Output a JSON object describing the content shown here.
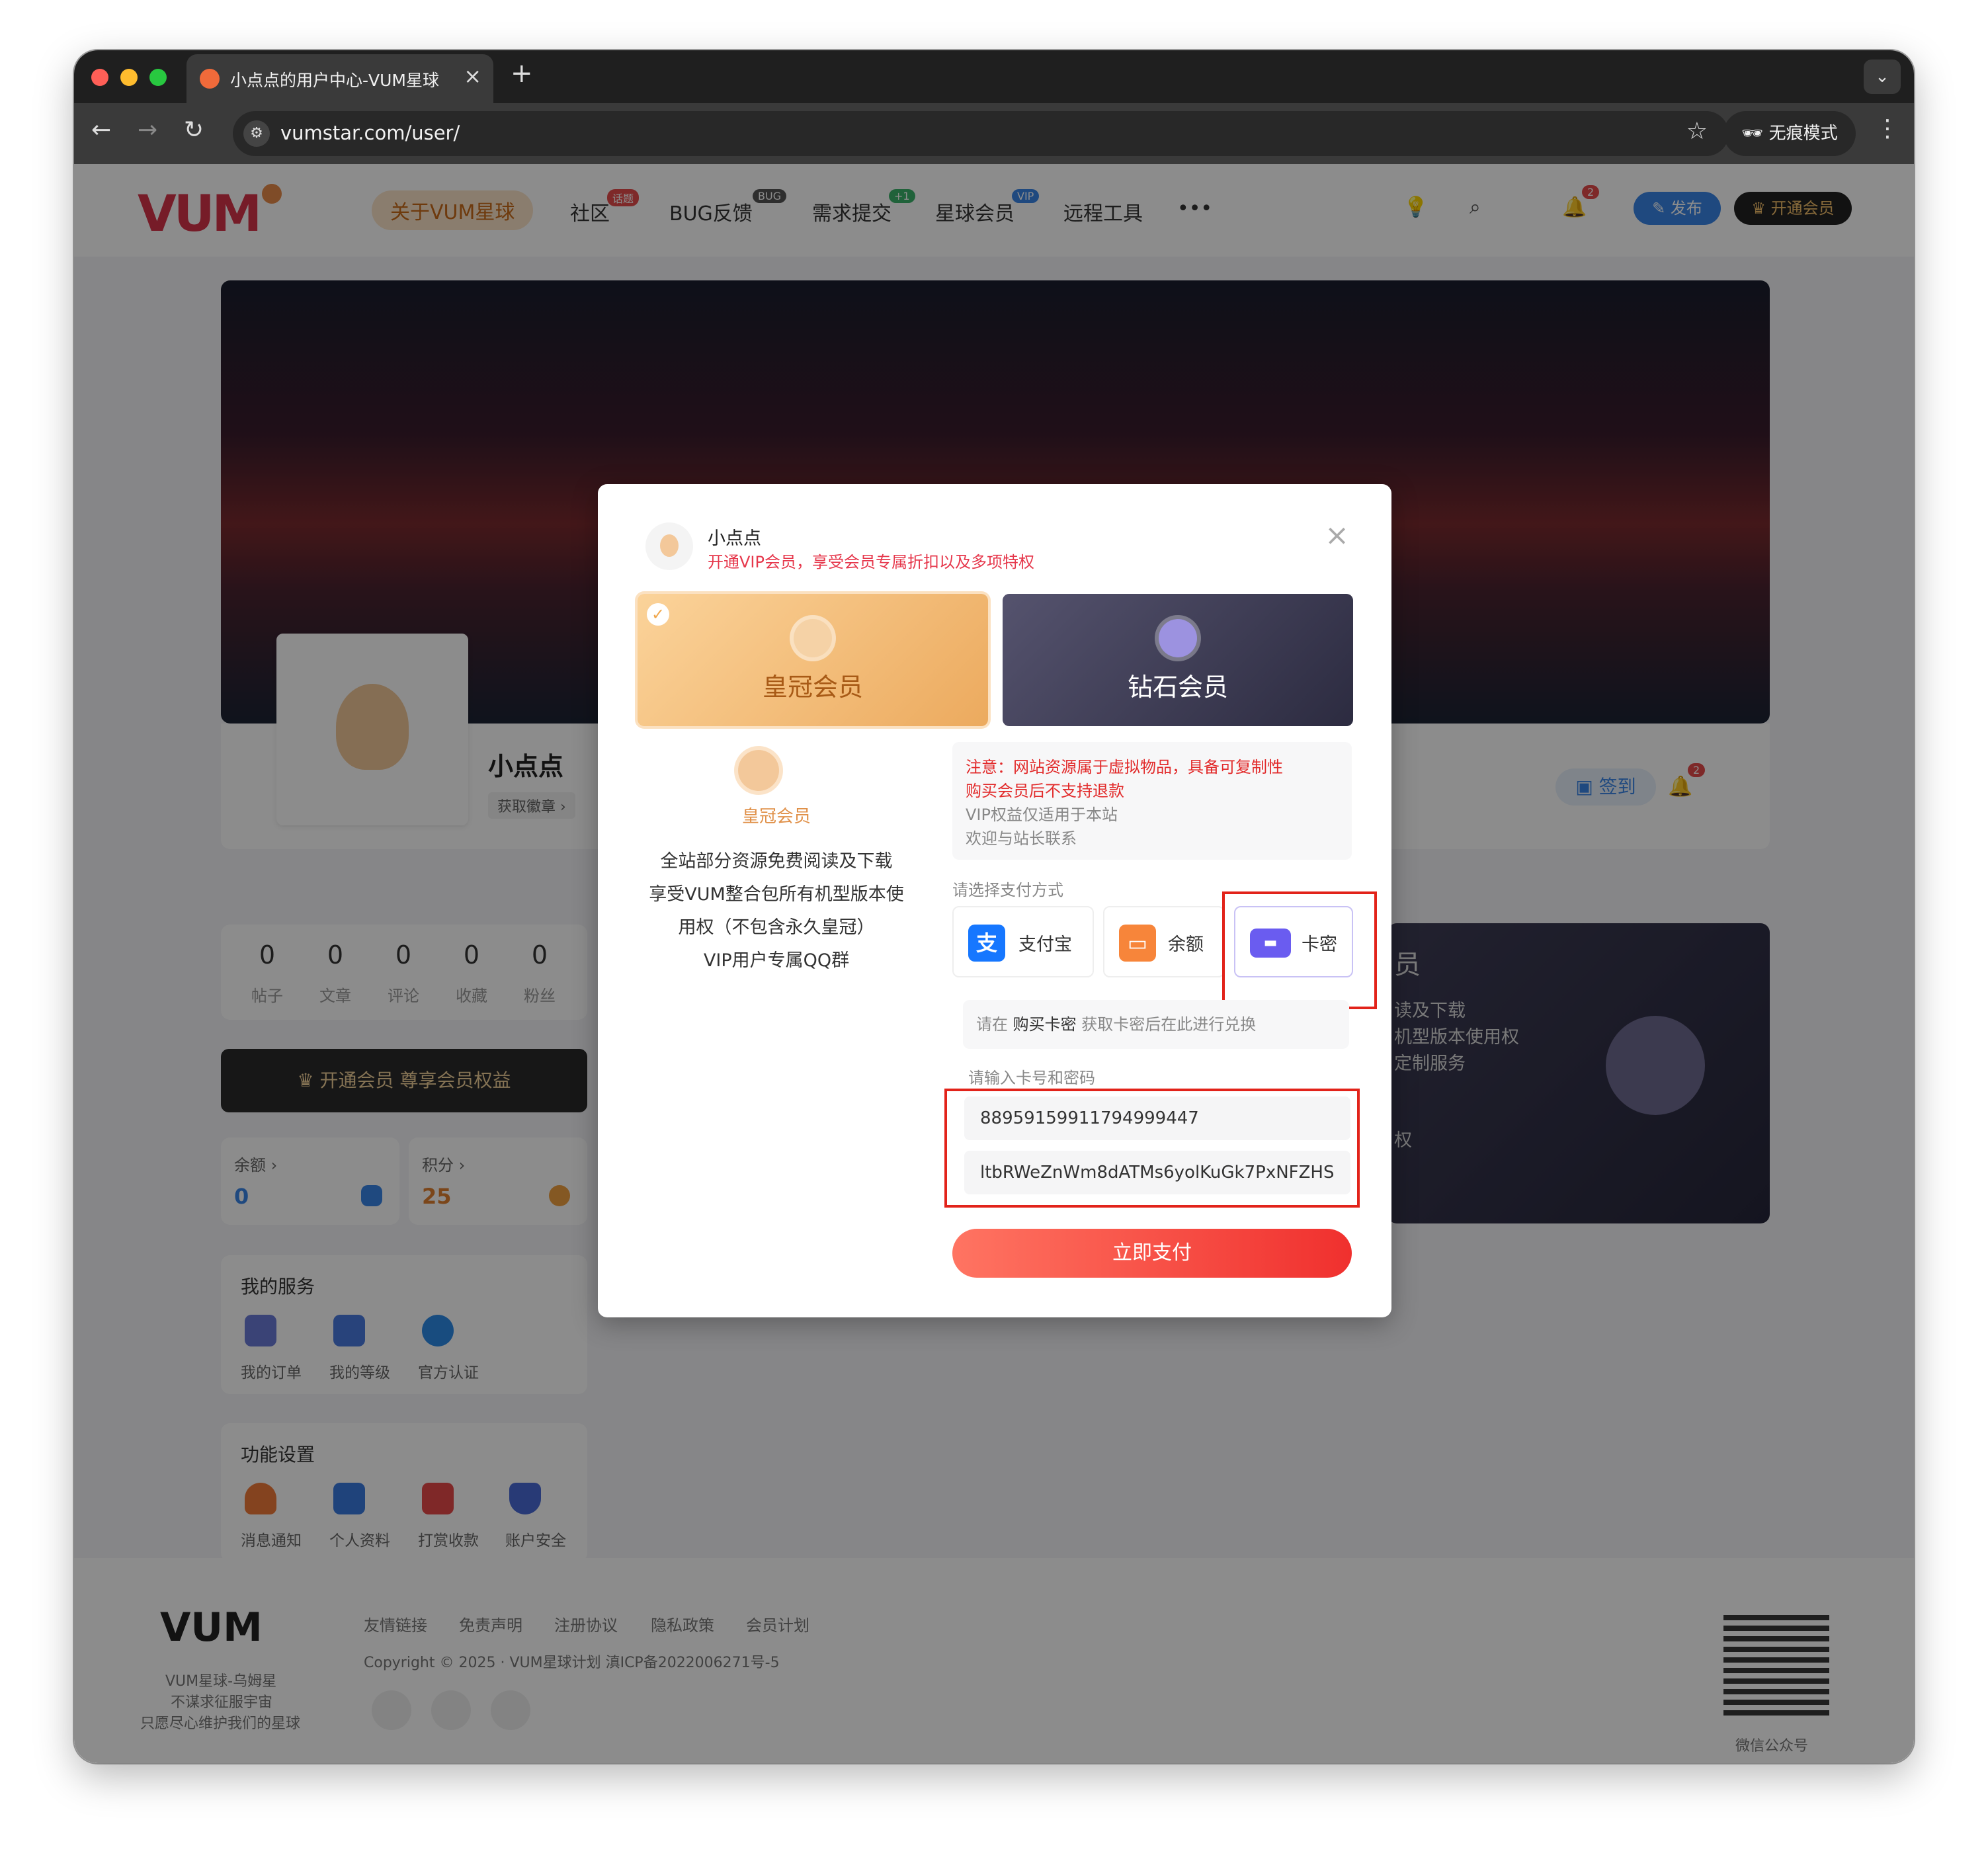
{
  "browser": {
    "tab_title": "小点点的用户中心-VUM星球",
    "url": "vumstar.com/user/",
    "incognito_label": "无痕模式"
  },
  "site_nav": {
    "logo_text": "VUM",
    "items": [
      {
        "label": "关于VUM星球",
        "badge": ""
      },
      {
        "label": "社区",
        "badge": "话题"
      },
      {
        "label": "BUG反馈",
        "badge": "BUG"
      },
      {
        "label": "需求提交",
        "badge": "+1"
      },
      {
        "label": "星球会员",
        "badge": "VIP"
      },
      {
        "label": "远程工具",
        "badge": ""
      }
    ],
    "more_label": "•••",
    "notify_count": "2",
    "publish_label": "发布",
    "vip_label": "开通会员"
  },
  "profile": {
    "username": "小点点",
    "get_badge": "获取徽章 ›",
    "checkin_label": "签到",
    "notify_count": "2",
    "stats": [
      {
        "value": "0",
        "label": "帖子"
      },
      {
        "value": "0",
        "label": "文章"
      },
      {
        "value": "0",
        "label": "评论"
      },
      {
        "value": "0",
        "label": "收藏"
      },
      {
        "value": "0",
        "label": "粉丝"
      }
    ],
    "vip_bar": "开通会员 尊享会员权益",
    "balance_label": "余额 ›",
    "balance_value": "0",
    "points_label": "积分 ›",
    "points_value": "25",
    "services_title": "我的服务",
    "services": [
      "我的订单",
      "我的等级",
      "官方认证"
    ],
    "settings_title": "功能设置",
    "settings": [
      "消息通知",
      "个人资料",
      "打赏收款",
      "账户安全"
    ]
  },
  "right_panel": {
    "title_fragment": "员",
    "lines": [
      "读及下载",
      "机型版本使用权",
      "定制服务",
      "权"
    ]
  },
  "footer": {
    "links": [
      "友情链接",
      "免责声明",
      "注册协议",
      "隐私政策",
      "会员计划"
    ],
    "copyright": "Copyright © 2025 · VUM星球计划 滇ICP备2022006271号-5",
    "tagline": [
      "VUM星球-乌姆星",
      "不谋求征服宇宙",
      "只愿尽心维护我们的星球"
    ],
    "qr_label": "微信公众号"
  },
  "modal": {
    "user_name": "小点点",
    "subtitle": "开通VIP会员，享受会员专属折扣以及多项特权",
    "plans": [
      {
        "label": "皇冠会员",
        "selected": true
      },
      {
        "label": "钻石会员",
        "selected": false
      }
    ],
    "selected_plan_name": "皇冠会员",
    "benefits": [
      "全站部分资源免费阅读及下载",
      "享受VUM整合包所有机型版本使",
      "用权（不包含永久皇冠）",
      "VIP用户专属QQ群"
    ],
    "notice": {
      "red_line1": "注意：网站资源属于虚拟物品，具备可复制性",
      "red_line2": "购买会员后不支持退款",
      "gray_line1": "VIP权益仅适用于本站",
      "gray_line2": "欢迎与站长联系"
    },
    "pay_method_label": "请选择支付方式",
    "pay_methods": [
      {
        "label": "支付宝",
        "color": "#1677ff"
      },
      {
        "label": "余额",
        "color": "#f7853a"
      },
      {
        "label": "卡密",
        "color": "#6a5cf0"
      }
    ],
    "hint_prefix": "请在",
    "hint_link": "购买卡密",
    "hint_suffix": "获取卡密后在此进行兑换",
    "input_label": "请输入卡号和密码",
    "card_number": "88959159911794999447",
    "card_password": "ltbRWeZnWm8dATMs6yolKuGk7PxNFZHS",
    "pay_button": "立即支付"
  },
  "colors": {
    "brand_red": "#d8344a",
    "alert_red": "#e22b2b",
    "pay_gradient_start": "#ff7462",
    "pay_gradient_end": "#f0302e"
  }
}
